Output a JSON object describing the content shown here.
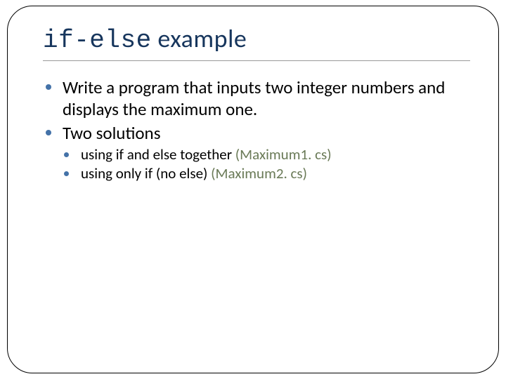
{
  "title": {
    "code": "if-else",
    "rest": " example"
  },
  "bullets": {
    "item1": "Write a program that inputs two integer numbers and displays the maximum one.",
    "item2": "Two solutions",
    "sub1_text": "using if and else together ",
    "sub1_paren": "(Maximum1. cs)",
    "sub2_text": "using only if (no else) ",
    "sub2_paren": "(Maximum2. cs)"
  }
}
